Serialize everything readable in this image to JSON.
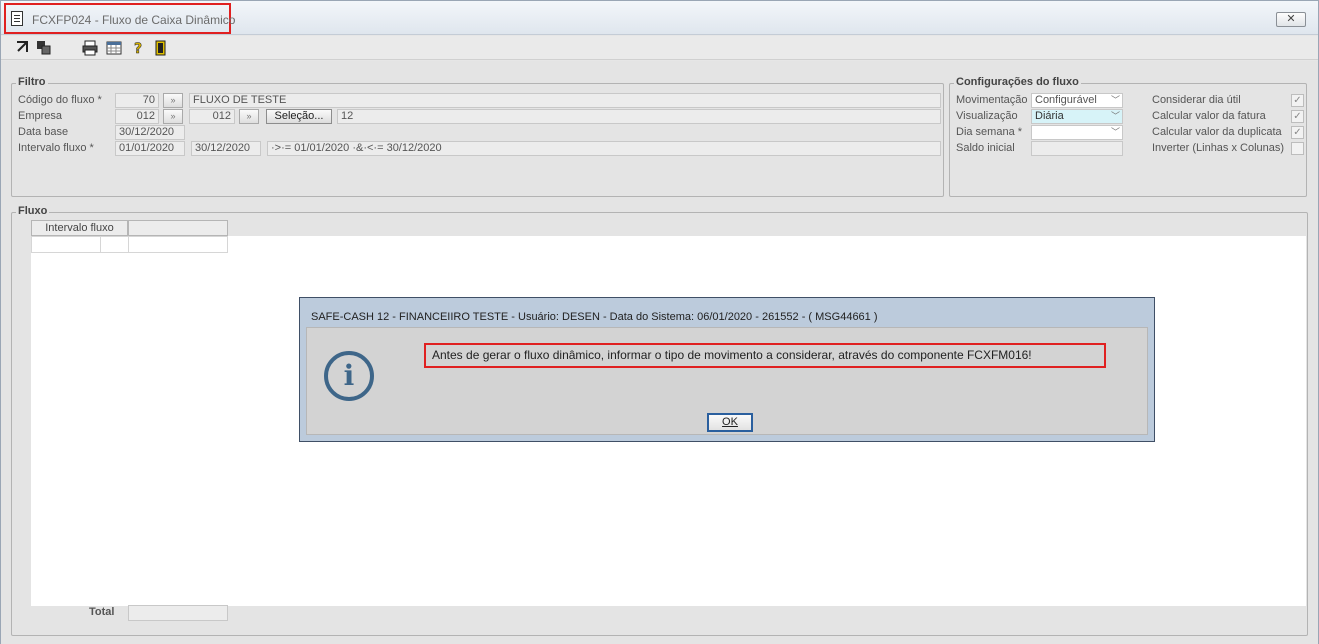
{
  "window": {
    "title": "FCXFP024 - Fluxo de Caixa Dinâmico",
    "close_label": "✕"
  },
  "toolbar": {
    "icons": [
      "arrow-icon",
      "layers-icon",
      "print-icon",
      "calendar-grid-icon",
      "help-icon",
      "exit-door-icon"
    ]
  },
  "filtro": {
    "legend": "Filtro",
    "codigo_label": "Código do fluxo *",
    "codigo_value": "70",
    "codigo_desc": "FLUXO DE TESTE",
    "empresa_label": "Empresa",
    "empresa_value": "012",
    "empresa_value2": "012",
    "selecao_label": "Seleção...",
    "empresa_desc": "12",
    "database_label": "Data base",
    "database_value": "30/12/2020",
    "intervalo_label": "Intervalo fluxo *",
    "intervalo_de": "01/01/2020",
    "intervalo_ate": "30/12/2020",
    "intervalo_expr": "·>·= 01/01/2020 ·&·<·= 30/12/2020"
  },
  "config": {
    "legend": "Configurações do fluxo",
    "movimentacao_label": "Movimentação",
    "movimentacao_value": "Configurável",
    "visualizacao_label": "Visualização",
    "visualizacao_value": "Diária",
    "diasemana_label": "Dia semana *",
    "diasemana_value": "",
    "saldo_label": "Saldo inicial",
    "saldo_value": "",
    "considerar_label": "Considerar dia útil",
    "calc_fatura_label": "Calcular valor da fatura",
    "calc_duplicata_label": "Calcular valor da duplicata",
    "inverter_label": "Inverter (Linhas x Colunas)",
    "checks": {
      "considerar": true,
      "calc_fatura": true,
      "calc_duplicata": true,
      "inverter": false
    }
  },
  "fluxo": {
    "legend": "Fluxo",
    "col_intervalo": "Intervalo fluxo",
    "total_label": "Total"
  },
  "dialog": {
    "title": "SAFE-CASH 12 - FINANCEIIRO TESTE - Usuário: DESEN - Data do Sistema: 06/01/2020 - 261552 - ( MSG44661 )",
    "message": "Antes de gerar o fluxo dinâmico, informar o tipo de movimento a considerar, através do componente FCXFM016!",
    "ok_label": "OK"
  }
}
